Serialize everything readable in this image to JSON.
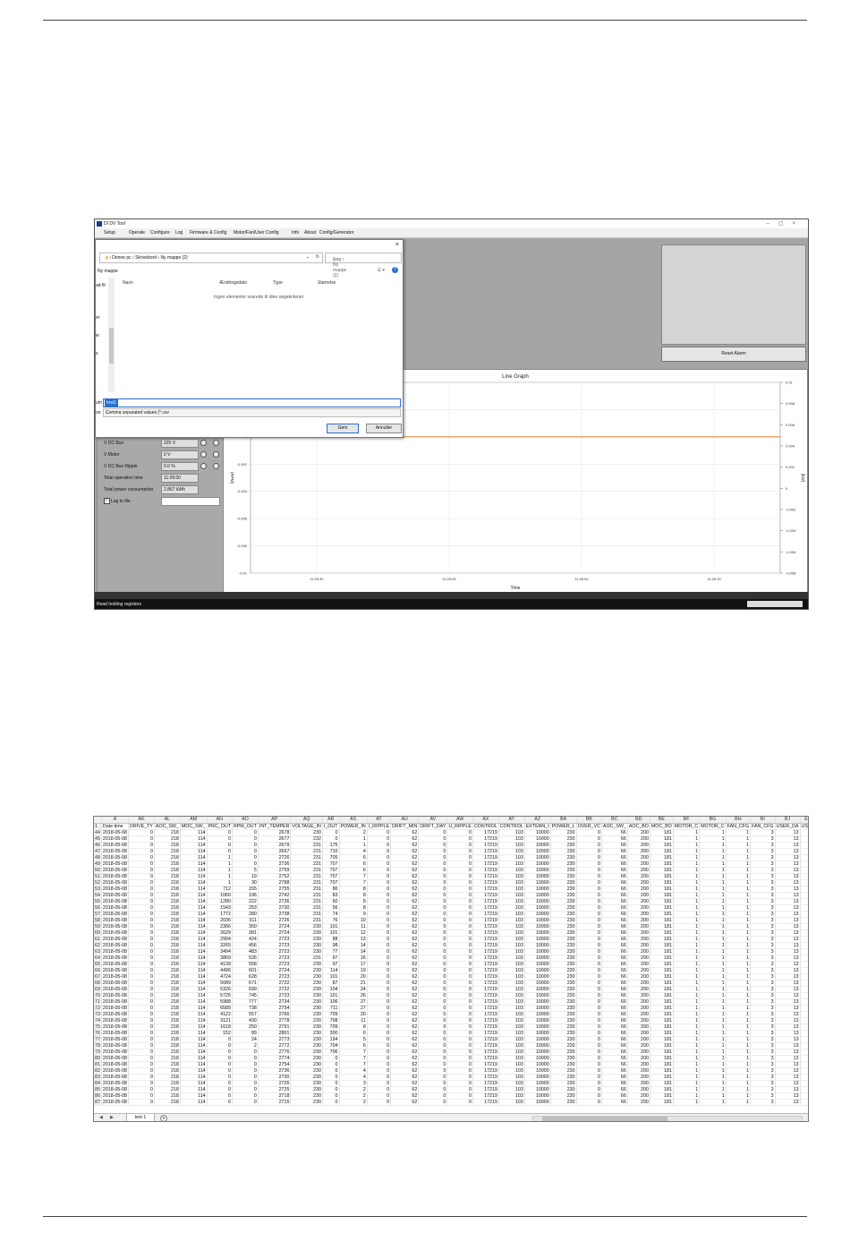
{
  "app": {
    "title": "DI DV Tool",
    "menu": [
      "Setup",
      "Operate",
      "Configure",
      "Log",
      "Firmware & Config",
      "Motor/Fan/User Config",
      "Info",
      "About",
      "Config/Generator"
    ],
    "reset_alarm": "Reset Alarm",
    "status": "Read holding registers"
  },
  "dialog": {
    "breadcrumb": [
      "Denne pc",
      "Skrivebord",
      "Ny mappe (2)"
    ],
    "search_placeholder": "Søg i Ny mappe (2)",
    "folder": "Ny mappe",
    "columns": [
      "Navn",
      "Ændringsdato",
      "Type",
      "Størrelse"
    ],
    "empty_message": "Ingen elementer svarede til dine søgekriterier.",
    "filename_label": "um",
    "filename": "test1",
    "filetype_label": "oo",
    "filetype": "Comma separated values (*.csv",
    "save": "Gem",
    "cancel": "Annuller",
    "nav_labels": [
      "ad fil",
      "er",
      "ie",
      "s"
    ]
  },
  "params": [
    {
      "label": "V DC Bus",
      "value": "225 V",
      "radios": true
    },
    {
      "label": "V Motor",
      "value": "0 V",
      "radios": true
    },
    {
      "label": "V DC Bus Ripple",
      "value": "0.0 %",
      "radios": true
    },
    {
      "label": "Total operation time",
      "value": "11:09:00",
      "radios": false
    },
    {
      "label": "Total power consumption",
      "value": "2.867 kWh",
      "radios": false
    }
  ],
  "log_to_file": "Log to file",
  "chart_data": {
    "type": "line",
    "title": "Line Graph",
    "xlabel": "Time",
    "ylabel": "[RPM]",
    "y2label": "[kW]",
    "x_ticks": [
      "11:25:30",
      "11:25:45",
      "11:26:00",
      "11:26:15"
    ],
    "y_ticks": [
      "0.004",
      "0.002",
      "0",
      "-0.002",
      "-0.004",
      "-0.006",
      "-0.008",
      "-0.01"
    ],
    "y2_ticks": [
      "0.01",
      "0.008",
      "0.006",
      "0.004",
      "0.002",
      "0",
      "-0.002",
      "-0.004",
      "-0.006",
      "-0.008"
    ],
    "ylim": [
      -0.01,
      0.004
    ],
    "y2lim": [
      -0.008,
      0.01
    ],
    "series": [
      {
        "values": [
          0,
          0,
          0,
          0,
          0
        ],
        "color": "#e07b1a"
      }
    ],
    "grid": true
  },
  "sheet": {
    "letters": [
      "A",
      "AK",
      "AL",
      "AM",
      "AN",
      "AO",
      "AP",
      "AQ",
      "AR",
      "AS",
      "AT",
      "AU",
      "AV",
      "AW",
      "AX",
      "AY",
      "AZ",
      "BA",
      "BB",
      "BC",
      "BD",
      "BE",
      "BF",
      "BG",
      "BH",
      "BI",
      "BJ",
      "E"
    ],
    "headers": [
      "Date time",
      "DRIVE_TY",
      "AOC_SW_",
      "MOC_SW_",
      "PRC_OUT",
      "RPM_OUT",
      "INT_TEMPER",
      "VOLTAGE_IN",
      "I_OUT",
      "POWER_IN",
      "I_RIPPLE",
      "DRIFT_MIN",
      "DRIFT_DAY",
      "U_RIPPLE",
      "CONTROL",
      "CONTROL",
      "EXTERN_I",
      "POWER_L",
      "OVER_VC",
      "AOC_SW_",
      "AOC_BO",
      "MOC_BO",
      "MOTOR_C",
      "MOTOR_C",
      "FAN_CFG",
      "FAN_CFG",
      "USER_DA",
      "USE"
    ],
    "first_row": 44,
    "date": "2018-05-08",
    "const_a": [
      "0",
      "218",
      "114"
    ],
    "const_b": [
      "0",
      "62",
      "0",
      "0",
      "17219",
      "103",
      "10000",
      "230",
      "0",
      "66",
      "200",
      "181",
      "1",
      "1",
      "1",
      "3",
      "13",
      ""
    ],
    "rows": [
      [
        "0",
        "0",
        "2678",
        "230",
        "0",
        "2"
      ],
      [
        "0",
        "0",
        "2677",
        "232",
        "0",
        "1"
      ],
      [
        "0",
        "0",
        "2679",
        "231",
        "175",
        "1"
      ],
      [
        "0",
        "0",
        "2697",
        "231",
        "710",
        "4"
      ],
      [
        "1",
        "0",
        "2726",
        "231",
        "705",
        "6"
      ],
      [
        "1",
        "0",
        "2736",
        "231",
        "707",
        "6"
      ],
      [
        "1",
        "5",
        "2759",
        "231",
        "707",
        "6"
      ],
      [
        "1",
        "19",
        "2752",
        "231",
        "707",
        "7"
      ],
      [
        "1",
        "30",
        "2788",
        "231",
        "707",
        "7"
      ],
      [
        "712",
        "155",
        "2755",
        "231",
        "86",
        "8"
      ],
      [
        "1060",
        "196",
        "2742",
        "231",
        "83",
        "8"
      ],
      [
        "1280",
        "222",
        "2736",
        "231",
        "60",
        "8"
      ],
      [
        "1543",
        "253",
        "2730",
        "231",
        "56",
        "8"
      ],
      [
        "1772",
        "280",
        "2738",
        "231",
        "74",
        "9"
      ],
      [
        "2036",
        "311",
        "2726",
        "231",
        "76",
        "10"
      ],
      [
        "2366",
        "350",
        "2724",
        "230",
        "101",
        "11"
      ],
      [
        "2629",
        "381",
        "2724",
        "230",
        "101",
        "12"
      ],
      [
        "2994",
        "424",
        "2723",
        "230",
        "88",
        "13"
      ],
      [
        "3265",
        "456",
        "2723",
        "230",
        "98",
        "14"
      ],
      [
        "3494",
        "483",
        "2723",
        "230",
        "77",
        "14"
      ],
      [
        "3869",
        "526",
        "2723",
        "231",
        "97",
        "16"
      ],
      [
        "4139",
        "558",
        "2723",
        "230",
        "97",
        "17"
      ],
      [
        "4496",
        "601",
        "2724",
        "230",
        "114",
        "19"
      ],
      [
        "4724",
        "628",
        "2723",
        "230",
        "101",
        "20"
      ],
      [
        "5089",
        "671",
        "2722",
        "230",
        "87",
        "21"
      ],
      [
        "5326",
        "699",
        "2722",
        "230",
        "104",
        "24"
      ],
      [
        "5725",
        "745",
        "2723",
        "230",
        "101",
        "26"
      ],
      [
        "5988",
        "777",
        "2734",
        "230",
        "106",
        "27"
      ],
      [
        "6589",
        "738",
        "2734",
        "230",
        "711",
        "27"
      ],
      [
        "4122",
        "557",
        "2766",
        "230",
        "709",
        "20"
      ],
      [
        "3121",
        "439",
        "2778",
        "230",
        "708",
        "11"
      ],
      [
        "1618",
        "250",
        "2791",
        "230",
        "709",
        "8"
      ],
      [
        "152",
        "89",
        "2801",
        "230",
        "300",
        "6"
      ],
      [
        "0",
        "24",
        "2773",
        "230",
        "194",
        "5"
      ],
      [
        "0",
        "2",
        "2772",
        "230",
        "704",
        "6"
      ],
      [
        "0",
        "0",
        "2776",
        "230",
        "706",
        "7"
      ],
      [
        "0",
        "0",
        "2774",
        "230",
        "0",
        "7"
      ],
      [
        "0",
        "0",
        "2754",
        "230",
        "0",
        "7"
      ],
      [
        "0",
        "0",
        "2736",
        "230",
        "0",
        "4"
      ],
      [
        "0",
        "0",
        "2730",
        "230",
        "0",
        "4"
      ],
      [
        "0",
        "0",
        "2726",
        "230",
        "0",
        "3"
      ],
      [
        "0",
        "0",
        "2725",
        "230",
        "0",
        "2"
      ],
      [
        "0",
        "0",
        "2718",
        "230",
        "0",
        "2"
      ],
      [
        "0",
        "0",
        "2715",
        "230",
        "0",
        "2"
      ]
    ],
    "tab": "test 1"
  }
}
